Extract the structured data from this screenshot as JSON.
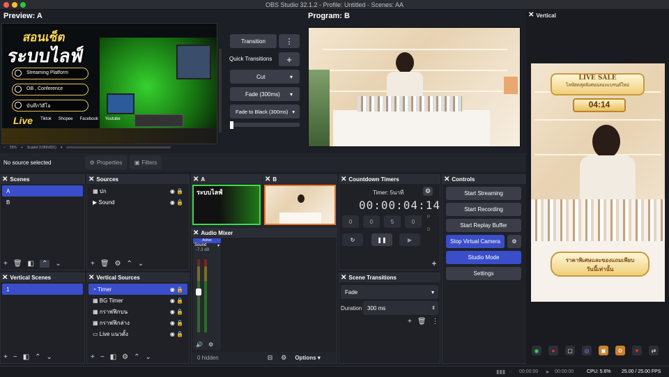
{
  "window": {
    "title": "OBS Studio 32.1.2 - Profile: Untitled - Scenes: AA"
  },
  "preview": {
    "label": "Preview: A",
    "zoom": "55%",
    "scale_label": "Scaled (1069x601)",
    "overlay": {
      "headline_top": "สอนเซ็ต",
      "headline_main": "ระบบไลฟ์",
      "items": [
        "Streaming Platform",
        "OB , Conference",
        "บันทึกวิดีโอ"
      ],
      "live_label": "Live",
      "platforms": [
        "Tiktok",
        "Shopee",
        "Facebook",
        "Youtube"
      ]
    }
  },
  "program": {
    "label": "Program: B"
  },
  "transitions": {
    "transition_btn": "Transition",
    "quick_label": "Quick Transitions",
    "items": [
      "Cut",
      "Fade (300ms)",
      "Fade to Black (300ms)"
    ],
    "more_icon": "kebab-icon",
    "add_icon": "plus-icon"
  },
  "source_toolbar": {
    "status": "No source selected",
    "properties": "Properties",
    "filters": "Filters"
  },
  "scenes": {
    "title": "Scenes",
    "items": [
      "A",
      "B"
    ],
    "selected": 0
  },
  "sources": {
    "title": "Sources",
    "items": [
      {
        "name": "ปก",
        "icon": "image-icon"
      },
      {
        "name": "Sound",
        "icon": "play-icon"
      }
    ]
  },
  "mini_a": {
    "title": "A"
  },
  "mini_b": {
    "title": "B"
  },
  "countdown": {
    "title": "Countdown Timers",
    "timer_name": "Timer: 5นาที",
    "time_display": "00:00:04:14",
    "fields": [
      "0",
      "0",
      "5",
      "0"
    ],
    "p_label": "P",
    "d_label": "D"
  },
  "controls": {
    "title": "Controls",
    "start_streaming": "Start Streaming",
    "start_recording": "Start Recording",
    "start_replay": "Start Replay Buffer",
    "stop_virtual": "Stop Virtual Camera",
    "studio_mode": "Studio Mode",
    "settings": "Settings"
  },
  "vertical": {
    "title": "Vertical",
    "live_sale": "LIVE SALE",
    "live_sub": "ไลฟ์สดสุดพิเศษฉลองแบรนด์ใหม่",
    "timer": "04:14",
    "bottom_text_1": "ราคาพิเศษและของแถมเพียบ",
    "bottom_text_2": "วันนี้เท่านั้น"
  },
  "vertical_scenes": {
    "title": "Vertical Scenes",
    "items": [
      "1"
    ]
  },
  "vertical_sources": {
    "title": "Vertical Sources",
    "items": [
      {
        "name": "Timer",
        "icon": "timer-icon",
        "selected": true
      },
      {
        "name": "BG Timer",
        "icon": "image-icon"
      },
      {
        "name": "กราฟฟิกบน",
        "icon": "image-icon"
      },
      {
        "name": "กราฟฟิกล่าง",
        "icon": "image-icon"
      },
      {
        "name": "Live แนวตั้ง",
        "icon": "camera-icon"
      }
    ]
  },
  "audio_mixer": {
    "title": "Audio Mixer",
    "active_label": "Active",
    "channel": "Sound",
    "db": "-7.3 dB",
    "hidden": "0 hidden",
    "options": "Options"
  },
  "scene_transitions": {
    "title": "Scene Transitions",
    "type": "Fade",
    "duration_label": "Duration",
    "duration_value": "300 ms"
  },
  "status": {
    "rec_time": "00:00:00",
    "stream_time": "00:00:00",
    "cpu": "CPU: 5.6%",
    "fps": "25.00 / 25.00 FPS"
  },
  "colors": {
    "accent": "#3a4ec9",
    "bg": "#1d1f26",
    "panel": "#23252c"
  }
}
